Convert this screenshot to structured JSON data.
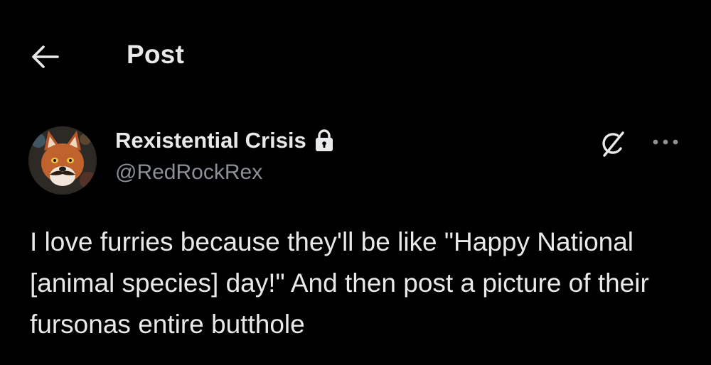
{
  "header": {
    "back_icon": "arrow-left-icon",
    "title": "Post"
  },
  "author": {
    "display_name": "Rexistential Crisis",
    "protected_icon": "lock-icon",
    "handle": "@RedRockRex",
    "avatar_icon": "fox-avatar"
  },
  "actions": {
    "grok_icon": "grok-icon",
    "more_icon": "more-horizontal-icon"
  },
  "post": {
    "text": "I love furries because they'll be like \"Happy National [animal species] day!\" And then post a picture of their fursonas entire butthole"
  },
  "colors": {
    "background": "#000000",
    "primary_text": "#e7e9ea",
    "secondary_text": "#8b9097"
  }
}
